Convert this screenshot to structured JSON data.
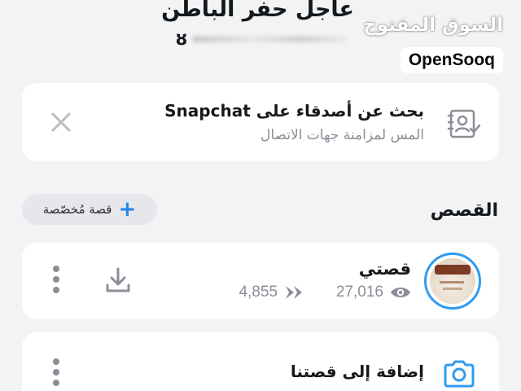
{
  "header": {
    "title": "عاجل حفر الباطن",
    "sub_glyph": "ȣ"
  },
  "watermark": {
    "arabic": "السوق المفتوح",
    "brand": "OpenSooq"
  },
  "find_friends": {
    "title": "بحث عن أصدقاء على Snapchat",
    "subtitle": "المس لمزامنة جهات الاتصال",
    "icon": "contacts-sync-icon",
    "close_icon": "close-icon"
  },
  "stories": {
    "section_title": "القصص",
    "custom_story_button": "قصة مُخصّصة",
    "custom_story_plus": "+",
    "my_story": {
      "name": "قصتي",
      "views": "27,016",
      "screenshots": "4,855"
    },
    "add_to_our_story": "إضافة إلى قصتنا"
  },
  "colors": {
    "accent": "#2f9bf0",
    "muted": "#8a8f97",
    "background": "#f2f3f5",
    "card": "#ffffff"
  }
}
